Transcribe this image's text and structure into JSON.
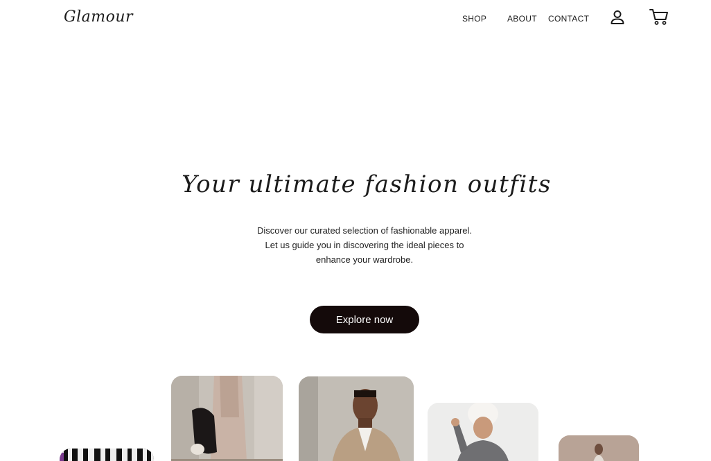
{
  "header": {
    "logo": "Glamour",
    "nav": {
      "shop": "SHOP",
      "about": "ABOUT",
      "contact": "CONTACT"
    },
    "icons": {
      "account": "user-icon",
      "cart": "cart-icon"
    }
  },
  "hero": {
    "title": "Your ultimate fashion outfits",
    "description_lines": [
      "Discover our curated selection of fashionable apparel.",
      "Let us guide you in discovering the ideal pieces to",
      "enhance your wardrobe."
    ],
    "cta_label": "Explore now"
  },
  "colors": {
    "background": "#ffffff",
    "text": "#1b1b1b",
    "button_bg": "#140a0a",
    "button_text": "#ffffff"
  },
  "gallery": {
    "images": [
      "fashion-photo",
      "fashion-photo",
      "fashion-photo",
      "fashion-photo",
      "fashion-photo"
    ]
  }
}
